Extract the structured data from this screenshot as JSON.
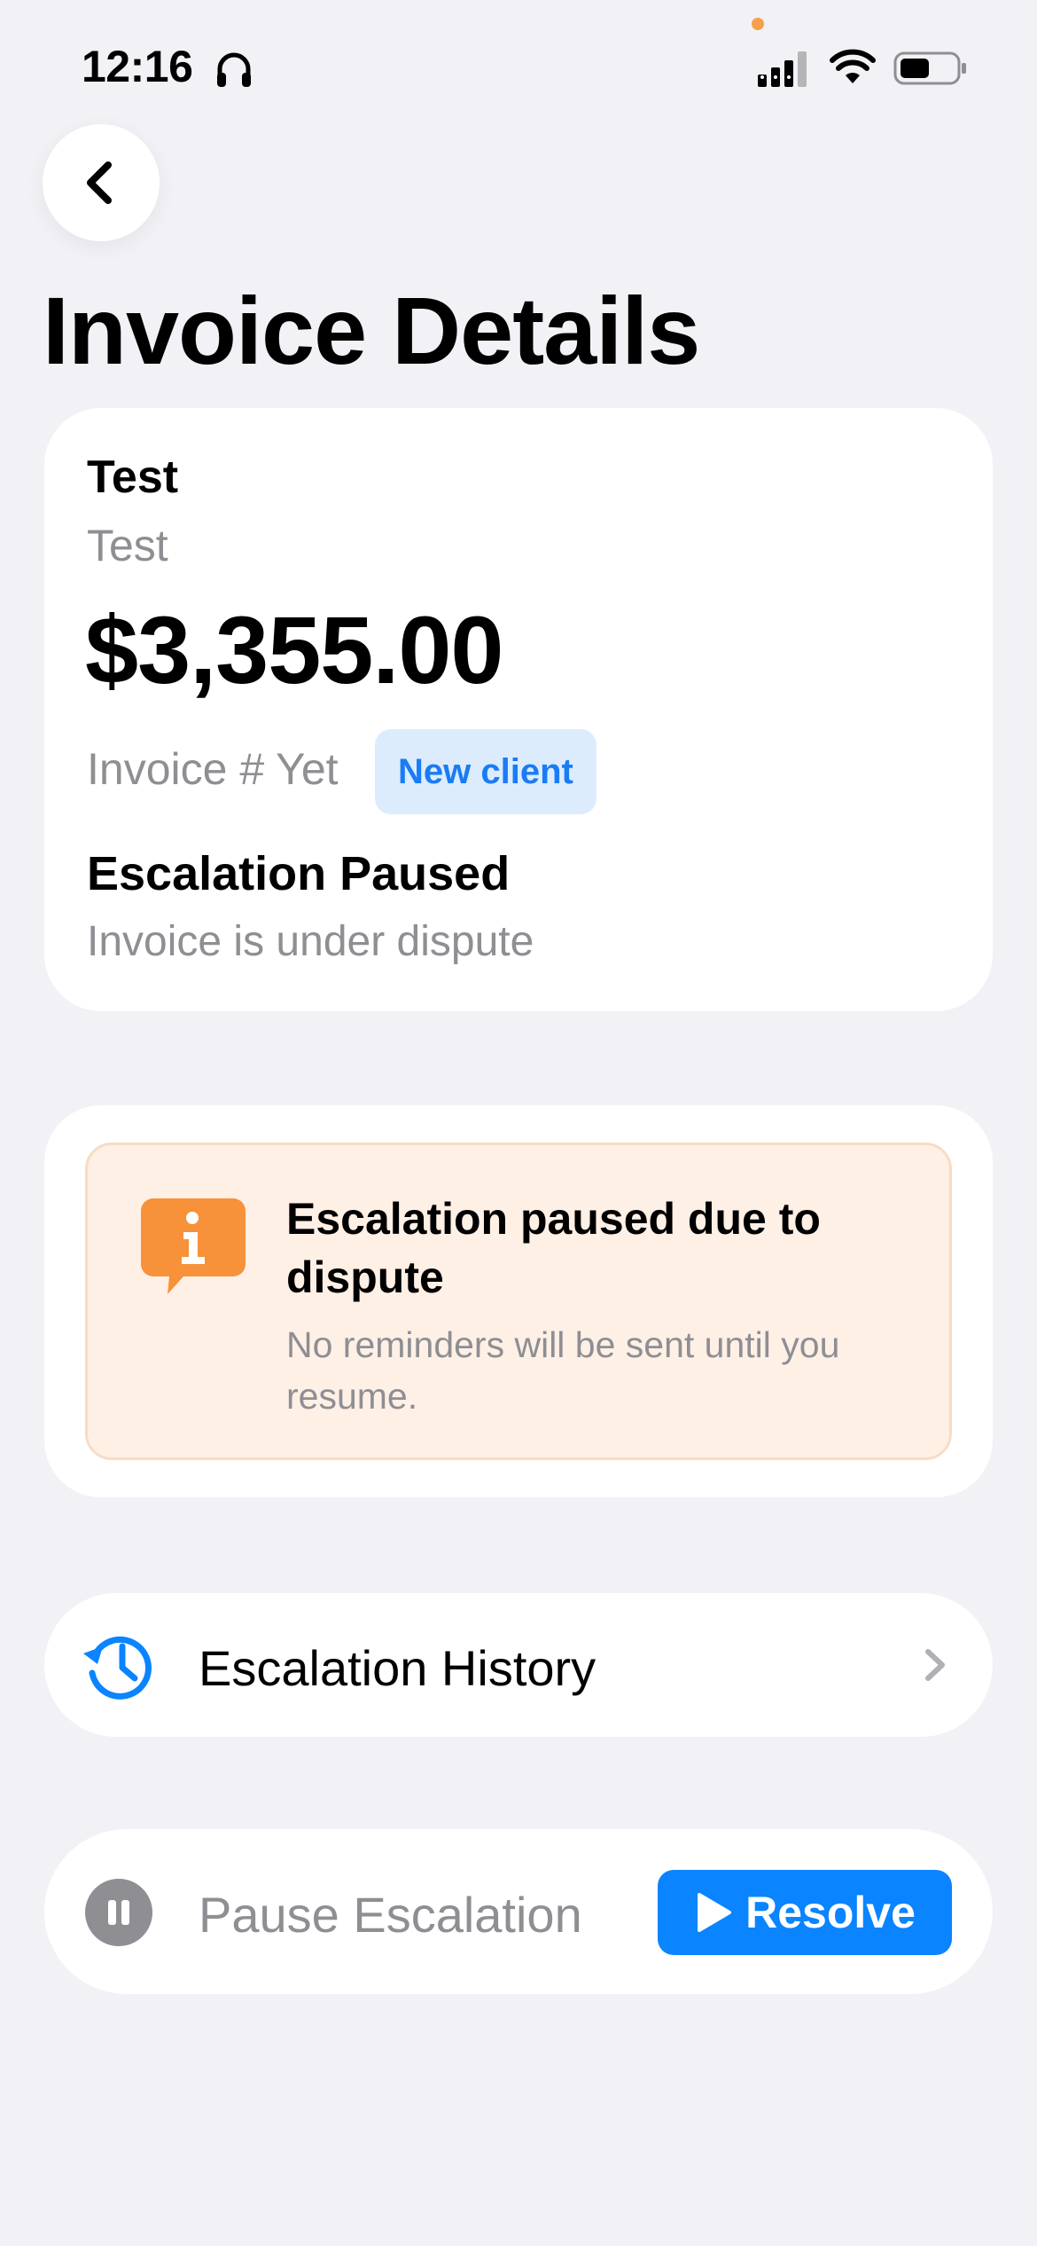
{
  "status_bar": {
    "time": "12:16",
    "icons": [
      "headphones-icon",
      "cellular-signal-icon",
      "wifi-icon",
      "battery-icon"
    ]
  },
  "nav": {
    "back_icon": "chevron-left-icon"
  },
  "page": {
    "title": "Invoice Details"
  },
  "summary": {
    "client_name": "Test",
    "client_sub": "Test",
    "amount": "$3,355.00",
    "invoice_number": "Invoice # Yet",
    "badge": "New client",
    "status_title": "Escalation Paused",
    "status_sub": "Invoice is under dispute"
  },
  "alert": {
    "icon": "info-bubble-icon",
    "title": "Escalation paused due to dispute",
    "body": "No reminders will be sent until you resume."
  },
  "history": {
    "icon": "history-clock-icon",
    "label": "Escalation History",
    "chevron_icon": "chevron-right-icon"
  },
  "actions": {
    "pause_icon": "pause-circle-icon",
    "pause_label": "Pause Escalation",
    "resolve_icon": "play-icon",
    "resolve_label": "Resolve"
  },
  "colors": {
    "background": "#f1f1f6",
    "accent": "#0a84ff",
    "badge_bg": "#dcecfd",
    "badge_text": "#1a7cf4",
    "warning": "#f7913a",
    "warning_bg": "#fff0e6",
    "secondary_text": "#8e8e93"
  }
}
